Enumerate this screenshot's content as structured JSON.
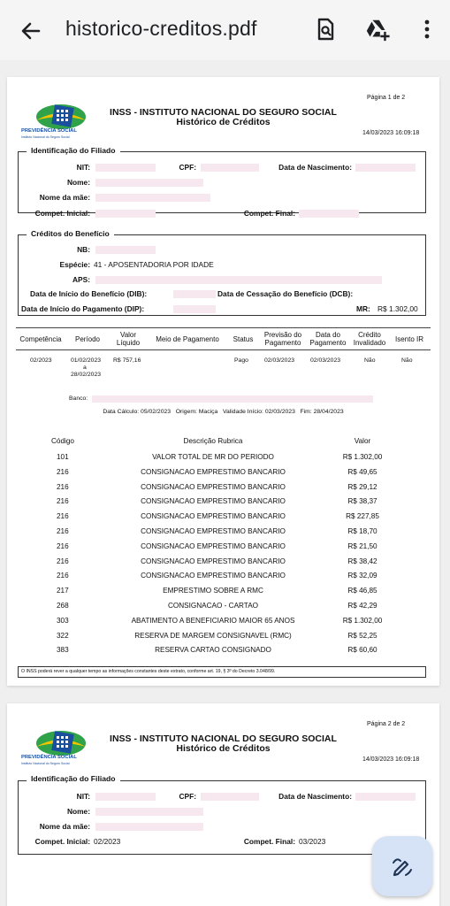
{
  "toolbar": {
    "title": "historico-creditos.pdf",
    "back_icon": "arrow-back-icon",
    "search_icon": "document-search-icon",
    "drive_icon": "drive-add-icon",
    "menu_icon": "more-vert-icon"
  },
  "header": {
    "org": "INSS - INSTITUTO NACIONAL DO SEGURO SOCIAL",
    "doc_title": "Histórico de Créditos",
    "logo_text": "PREVIDÊNCIA SOCIAL",
    "logo_sub": "Instituto Nacional do Seguro Social",
    "datetime": "14/03/2023 16:09:18"
  },
  "page1": {
    "page_label": "Página 1 de 2",
    "filiado": {
      "legend": "Identificação do Filiado",
      "nit_label": "NIT:",
      "cpf_label": "CPF:",
      "nasc_label": "Data de Nascimento:",
      "nome_label": "Nome:",
      "mae_label": "Nome da mãe:",
      "comp_ini_label": "Compet. Inicial:",
      "comp_fim_label": "Compet. Final:"
    },
    "beneficio": {
      "legend": "Créditos do Benefício",
      "nb_label": "NB:",
      "especie_label": "Espécie:",
      "especie_value": "41 - APOSENTADORIA POR IDADE",
      "aps_label": "APS:",
      "dib_label": "Data de Início do Benefício (DIB):",
      "dcb_label": "Data de Cessação do Benefício (DCB):",
      "dip_label": "Data de Início do Pagamento (DIP):",
      "mr_label": "MR:",
      "mr_value": "R$ 1.302,00"
    },
    "table": {
      "headers": [
        "Competência",
        "Período",
        "Valor\nLíquido",
        "Meio de Pagamento",
        "Status",
        "Previsão do\nPagamento",
        "Data do\nPagamento",
        "Crédito\nInvalidado",
        "Isento IR"
      ],
      "row": {
        "competencia": "02/2023",
        "periodo_ini": "01/02/2023",
        "periodo_a": "a",
        "periodo_fim": "28/02/2023",
        "valor": "R$ 757,16",
        "status": "Pago",
        "previsao": "02/03/2023",
        "data_pag": "02/03/2023",
        "invalidado": "Não",
        "isento": "Não"
      },
      "banco_label": "Banco:",
      "calc_line": "Data Cálculo: 05/02/2023   Origem: Maciça   Validade Início: 02/03/2023   Fim: 28/04/2023"
    },
    "rubricas": {
      "headers": [
        "Código",
        "Descrição Rubrica",
        "Valor"
      ],
      "rows": [
        {
          "codigo": "101",
          "descricao": "VALOR TOTAL DE MR DO PERIODO",
          "valor": "R$ 1.302,00"
        },
        {
          "codigo": "216",
          "descricao": "CONSIGNACAO EMPRESTIMO BANCARIO",
          "valor": "R$ 49,65"
        },
        {
          "codigo": "216",
          "descricao": "CONSIGNACAO EMPRESTIMO BANCARIO",
          "valor": "R$ 29,12"
        },
        {
          "codigo": "216",
          "descricao": "CONSIGNACAO EMPRESTIMO BANCARIO",
          "valor": "R$ 38,37"
        },
        {
          "codigo": "216",
          "descricao": "CONSIGNACAO EMPRESTIMO BANCARIO",
          "valor": "R$ 227,85"
        },
        {
          "codigo": "216",
          "descricao": "CONSIGNACAO EMPRESTIMO BANCARIO",
          "valor": "R$ 18,70"
        },
        {
          "codigo": "216",
          "descricao": "CONSIGNACAO EMPRESTIMO BANCARIO",
          "valor": "R$ 21,50"
        },
        {
          "codigo": "216",
          "descricao": "CONSIGNACAO EMPRESTIMO BANCARIO",
          "valor": "R$ 38,42"
        },
        {
          "codigo": "216",
          "descricao": "CONSIGNACAO EMPRESTIMO BANCARIO",
          "valor": "R$ 32,09"
        },
        {
          "codigo": "217",
          "descricao": "EMPRESTIMO SOBRE A RMC",
          "valor": "R$ 46,85"
        },
        {
          "codigo": "268",
          "descricao": "CONSIGNACAO - CARTAO",
          "valor": "R$ 42,29"
        },
        {
          "codigo": "303",
          "descricao": "ABATIMENTO A BENEFICIARIO MAIOR 65 ANOS",
          "valor": "R$ 1.302,00"
        },
        {
          "codigo": "322",
          "descricao": "RESERVA DE MARGEM CONSIGNAVEL (RMC)",
          "valor": "R$ 52,25"
        },
        {
          "codigo": "383",
          "descricao": "RESERVA CARTAO CONSIGNADO",
          "valor": "R$ 60,60"
        }
      ]
    },
    "footer_note": "O INSS poderá rever a qualquer tempo as informações constantes deste extrato, conforme art. 19, § 3º do Decreto 3.048/99."
  },
  "page2": {
    "page_label": "Página 2 de 2",
    "filiado": {
      "legend": "Identificação do Filiado",
      "nit_label": "NIT:",
      "cpf_label": "CPF:",
      "nasc_label": "Data de Nascimento:",
      "nome_label": "Nome:",
      "mae_label": "Nome da mãe:",
      "comp_ini_label": "Compet. Inicial:",
      "comp_ini_value": "02/2023",
      "comp_fim_label": "Compet. Final:",
      "comp_fim_value": "03/2023"
    }
  },
  "fab": {
    "icon": "edit-pen-icon"
  }
}
